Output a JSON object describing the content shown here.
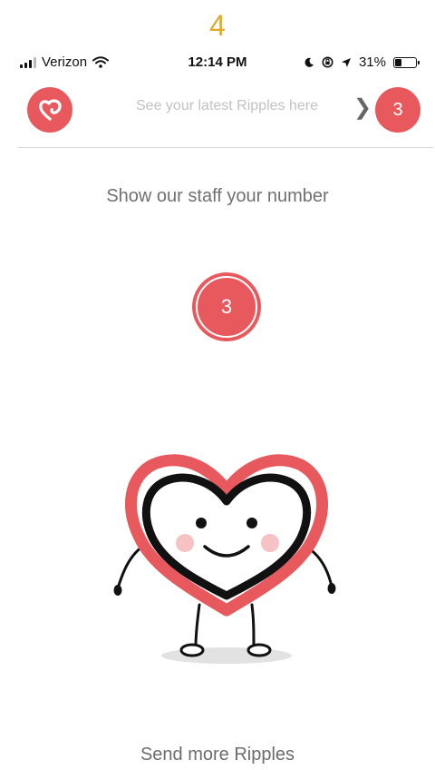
{
  "step_label": "4",
  "status_bar": {
    "carrier": "Verizon",
    "time": "12:14 PM",
    "battery": "31%",
    "battery_level": 0.31,
    "icons": [
      "signal-icon",
      "wifi-icon",
      "moon-icon",
      "orientation-lock-icon",
      "location-arrow-icon",
      "battery-icon"
    ]
  },
  "header": {
    "ripples_link": "See your latest Ripples here",
    "count": "3",
    "icons": [
      "heart-logo-icon",
      "chevron-right-icon"
    ]
  },
  "main": {
    "prompt": "Show our staff your number",
    "number": "3",
    "send_more": "Send more Ripples"
  },
  "colors": {
    "accent": "#E8595E",
    "step_label": "#E0AA2E",
    "cheek": "#F7C2C4",
    "muted_text": "#c2c2c2"
  }
}
